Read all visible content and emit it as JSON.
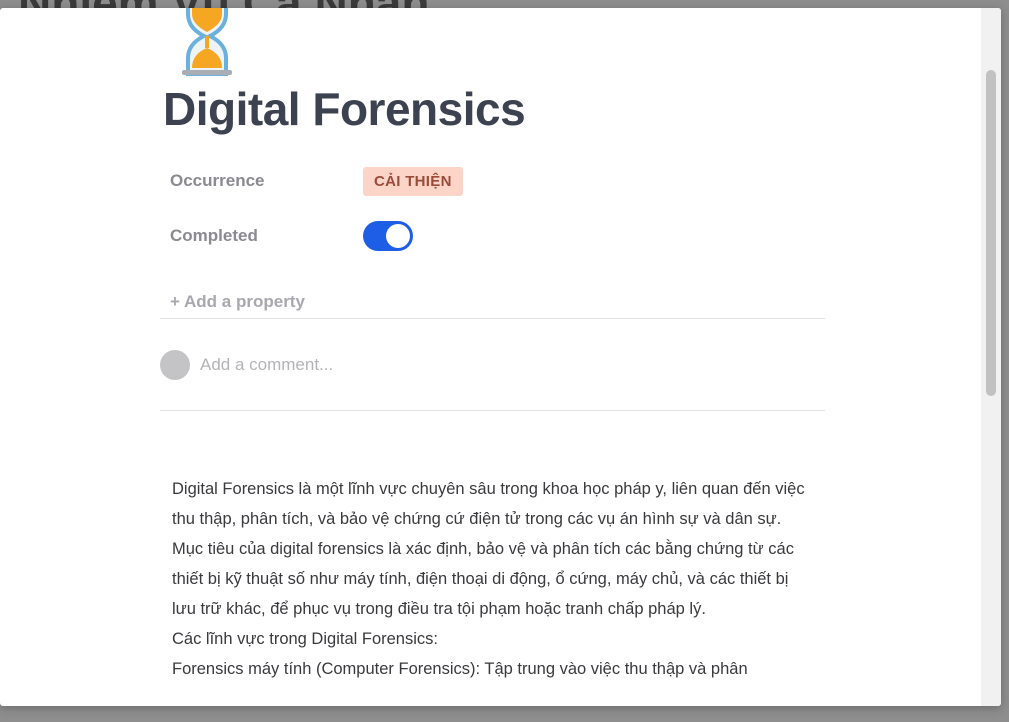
{
  "background": {
    "title_fragment": "Nhiệm Vụ Cá Nhân"
  },
  "page": {
    "icon": "hourglass-icon",
    "title": "Digital Forensics"
  },
  "properties": {
    "occurrence": {
      "label": "Occurrence",
      "tag": "CẢI THIỆN",
      "tag_color": "#fdd5c8"
    },
    "completed": {
      "label": "Completed",
      "value": true,
      "toggle_color": "#1e5ee6"
    },
    "add_label": "+ Add a property"
  },
  "comment": {
    "placeholder": "Add a comment..."
  },
  "content": {
    "paragraph_1": "Digital Forensics là một lĩnh vực chuyên sâu trong khoa học pháp y, liên quan đến việc thu thập, phân tích, và bảo vệ chứng cứ điện tử trong các vụ án hình sự và dân sự. Mục tiêu của digital forensics là xác định, bảo vệ và phân tích các bằng chứng từ các thiết bị kỹ thuật số như máy tính, điện thoại di động, ổ cứng, máy chủ, và các thiết bị lưu trữ khác, để phục vụ trong điều tra tội phạm hoặc tranh chấp pháp lý.",
    "paragraph_2": "Các lĩnh vực trong Digital Forensics:",
    "paragraph_3": "Forensics máy tính (Computer Forensics): Tập trung vào việc thu thập và phân"
  }
}
